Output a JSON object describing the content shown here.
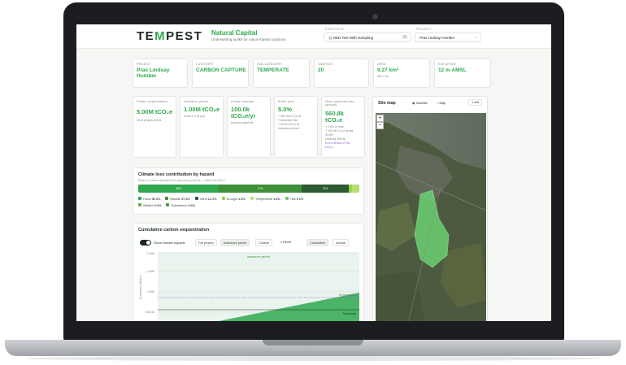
{
  "header": {
    "logo_part1": "TE",
    "logo_accent": "M",
    "logo_part2": "PEST",
    "brand": "Natural Capital",
    "tagline": "Underwriting toolkit for nature-based solutions",
    "portfolio_label": "PORTFOLIO",
    "portfolio_value": "NDD Test With Sampling",
    "portfolio_count": "(6)",
    "project_label": "PROJECT",
    "project_value": "Prax Lindsay Humber"
  },
  "summary": [
    {
      "label": "Project",
      "value": "Prax Lindsay Humber"
    },
    {
      "label": "Category",
      "value": "CARBON CAPTURE"
    },
    {
      "label": "Sub-category",
      "value": "TEMPERATE"
    },
    {
      "label": "Samples",
      "value": "20"
    },
    {
      "label": "Area",
      "value": "9.27 km²",
      "sub": "926.7 ha"
    },
    {
      "label": "Elevation",
      "value": "12 m AMSL"
    }
  ],
  "metrics": [
    {
      "label": "Project sequestration",
      "value": "5.00M tCO₂e",
      "sub": "25-yr project period"
    },
    {
      "label": "Insurance period",
      "value": "1.00M tCO₂e",
      "sub": "Years 1-5 (5 yrs)"
    },
    {
      "label": "Annual average",
      "value": "100.0k tCO₂e/yr",
      "sub": "Across project life"
    },
    {
      "label": "Buffer pool",
      "value": "5.0%",
      "sub1": "+ 250.0k tCO₂e at",
      "sub2": "+ absorbed risk",
      "sub3": "+ 50.0k tCO₂e at",
      "sub4": "insurance period"
    },
    {
      "label": "Mean expected loss (annual)",
      "value": "560.8k tCO₂e",
      "sub1": "+ 2.8% of total",
      "sub2": "+ 100.0k tCO₂e at risk",
      "sub3": "30.8%",
      "sub4": "covering 259.9k",
      "sub5": "tCO₂e at loss 27.0k",
      "sub6": "tCO₂e"
    }
  ],
  "hazard": {
    "title": "Climate loss contribution by hazard",
    "note": "Share of mean expected loss (insurance period) — total 218 tCO₂e",
    "segments": [
      {
        "label": "36%",
        "share": 36.3,
        "color": "#2fa84f"
      },
      {
        "label": "37%",
        "share": 37.4,
        "color": "#3f8f3a"
      },
      {
        "label": "21%",
        "share": 21.1,
        "color": "#2b5a33"
      },
      {
        "label": "",
        "share": 1.3,
        "color": "#9ad14a"
      },
      {
        "label": "",
        "share": 3.4,
        "color": "#b8df72"
      }
    ],
    "legend": [
      {
        "name": "Flood",
        "value": "36.3%",
        "color": "#2fa84f"
      },
      {
        "name": "Rainfall",
        "value": "37.4%",
        "color": "#3f8f3a"
      },
      {
        "name": "Wind",
        "value": "21.1%",
        "color": "#2b5a33"
      },
      {
        "name": "Drought",
        "value": "1.3%",
        "color": "#9ad14a"
      },
      {
        "name": "Temperature",
        "value": "3.4%",
        "color": "#b8df72"
      },
      {
        "name": "Hail",
        "value": "0.1%",
        "color": "#7fc46a"
      },
      {
        "name": "Wildfire",
        "value": "0.2%",
        "color": "#5fb04f"
      },
      {
        "name": "Subsidence",
        "value": "0.6%",
        "color": "#4b9a47"
      }
    ]
  },
  "sequestration": {
    "title": "Cumulative carbon sequestration",
    "toggle_label": "Show climate impacts",
    "buttons": [
      "Full project",
      "Insurance period",
      "Custom"
    ],
    "reset_label": "Reset",
    "modes": [
      "Cumulative",
      "Annual"
    ],
    "band_label": "Insurance period",
    "y_axis_label": "Cumulative (tCO₂e)",
    "ticks": [
      "2.00M",
      "1.50M",
      "1.00M",
      "500.0k"
    ],
    "line_label1": "Expected loss",
    "line_label2": "Total mean"
  },
  "map": {
    "title": "Site map",
    "satellite": "Satellite",
    "map_option": "Map",
    "site_btn": "1 site",
    "zoom_in": "+",
    "zoom_out": "−"
  }
}
